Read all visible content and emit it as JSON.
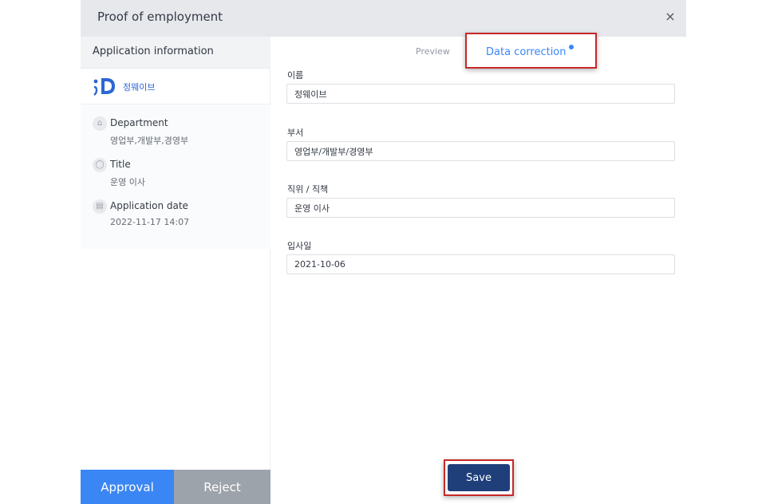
{
  "header": {
    "title": "Proof of employment",
    "close_icon": "×"
  },
  "sidebar": {
    "heading": "Application information",
    "org": {
      "logo_icon": "id-logo",
      "name": "정웨이브"
    },
    "items": [
      {
        "icon": "department-icon",
        "glyph": "⌂",
        "label": "Department",
        "value": "영업부,개발부,경영부"
      },
      {
        "icon": "person-icon",
        "glyph": "◯",
        "label": "Title",
        "value": "운영 이사"
      },
      {
        "icon": "calendar-icon",
        "glyph": "▤",
        "label": "Application date",
        "value": "2022-11-17 14:07"
      }
    ],
    "approve_label": "Approval",
    "reject_label": "Reject"
  },
  "tabs": {
    "preview": "Preview",
    "correction": "Data correction"
  },
  "form": {
    "fields": [
      {
        "label": "이름",
        "value": "정웨이브"
      },
      {
        "label": "부서",
        "value": "영업부/개발부/경영부"
      },
      {
        "label": "직위 / 직책",
        "value": "운영 이사"
      },
      {
        "label": "입사일",
        "value": "2021-10-06"
      }
    ],
    "save_label": "Save"
  },
  "colors": {
    "accent": "#3a86f5",
    "save": "#1f3f7a",
    "highlight": "#c62828",
    "reject": "#9da3ab"
  }
}
